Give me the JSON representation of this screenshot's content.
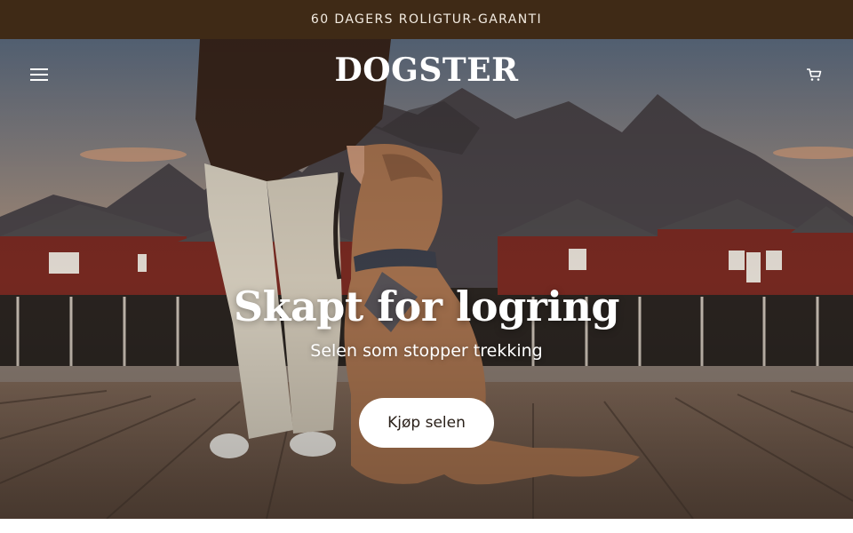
{
  "announcement": {
    "text": "60 DAGERS ROLIGTUR-GARANTI"
  },
  "header": {
    "logo": "DOGSTER",
    "menu_icon": "hamburger-menu-icon",
    "cart_icon": "shopping-cart-icon"
  },
  "hero": {
    "title": "Skapt for logring",
    "subtitle": "Selen som stopper trekking",
    "cta_label": "Kjøp selen"
  },
  "colors": {
    "announcement_bg": "#3f2a16",
    "announcement_text": "#f3ece2",
    "cta_bg": "#ffffff",
    "cta_text": "#2a2019"
  }
}
